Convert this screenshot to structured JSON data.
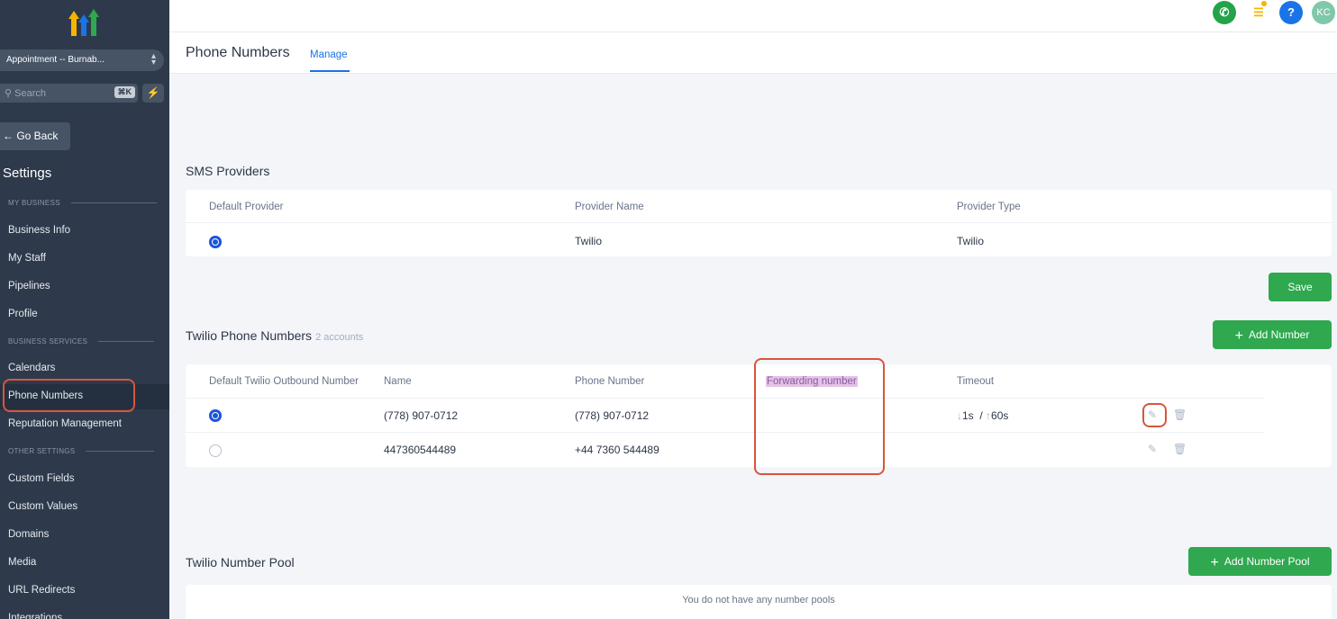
{
  "sidebar": {
    "location": "Appointment -- Burnab...",
    "search_placeholder": "Search",
    "search_shortcut": "⌘K",
    "quick_action_icon": "⚡",
    "go_back": "← Go Back",
    "settings_title": "Settings",
    "sections": {
      "my_business": "MY BUSINESS",
      "business_services": "BUSINESS SERVICES",
      "other_settings": "OTHER SETTINGS"
    },
    "items": {
      "business_info": "Business Info",
      "my_staff": "My Staff",
      "pipelines": "Pipelines",
      "profile": "Profile",
      "calendars": "Calendars",
      "phone_numbers": "Phone Numbers",
      "reputation": "Reputation Management",
      "custom_fields": "Custom Fields",
      "custom_values": "Custom Values",
      "domains": "Domains",
      "media": "Media",
      "url_redirects": "URL Redirects",
      "integrations": "Integrations"
    }
  },
  "topbar": {
    "avatar_initials": "KC",
    "help_glyph": "?",
    "phone_glyph": "✆",
    "tasks_glyph": "☰"
  },
  "header": {
    "title": "Phone Numbers",
    "tab_manage": "Manage"
  },
  "sms": {
    "title": "SMS Providers",
    "columns": [
      "Default Provider",
      "Provider Name",
      "Provider Type"
    ],
    "row": {
      "name": "Twilio",
      "type": "Twilio"
    },
    "save_label": "Save"
  },
  "twilio": {
    "title": "Twilio Phone Numbers",
    "count": "2 accounts",
    "add_label": "Add Number",
    "columns": [
      "Default Twilio Outbound Number",
      "Name",
      "Phone Number",
      "Forwarding number",
      "Timeout"
    ],
    "rows": [
      {
        "name": "(778) 907-0712",
        "phone": "(778) 907-0712",
        "timeout_in": "1s",
        "timeout_out": "60s"
      },
      {
        "name": "447360544489",
        "phone": "+44 7360 544489"
      }
    ]
  },
  "pool": {
    "title": "Twilio Number Pool",
    "add_label": "Add Number Pool",
    "empty": "You do not have any number pools"
  },
  "colors": {
    "sidebar_bg": "#2e3a4b",
    "accent_blue": "#1a73e8",
    "button_green": "#2fa84f",
    "annotation_red": "#d9553c"
  }
}
